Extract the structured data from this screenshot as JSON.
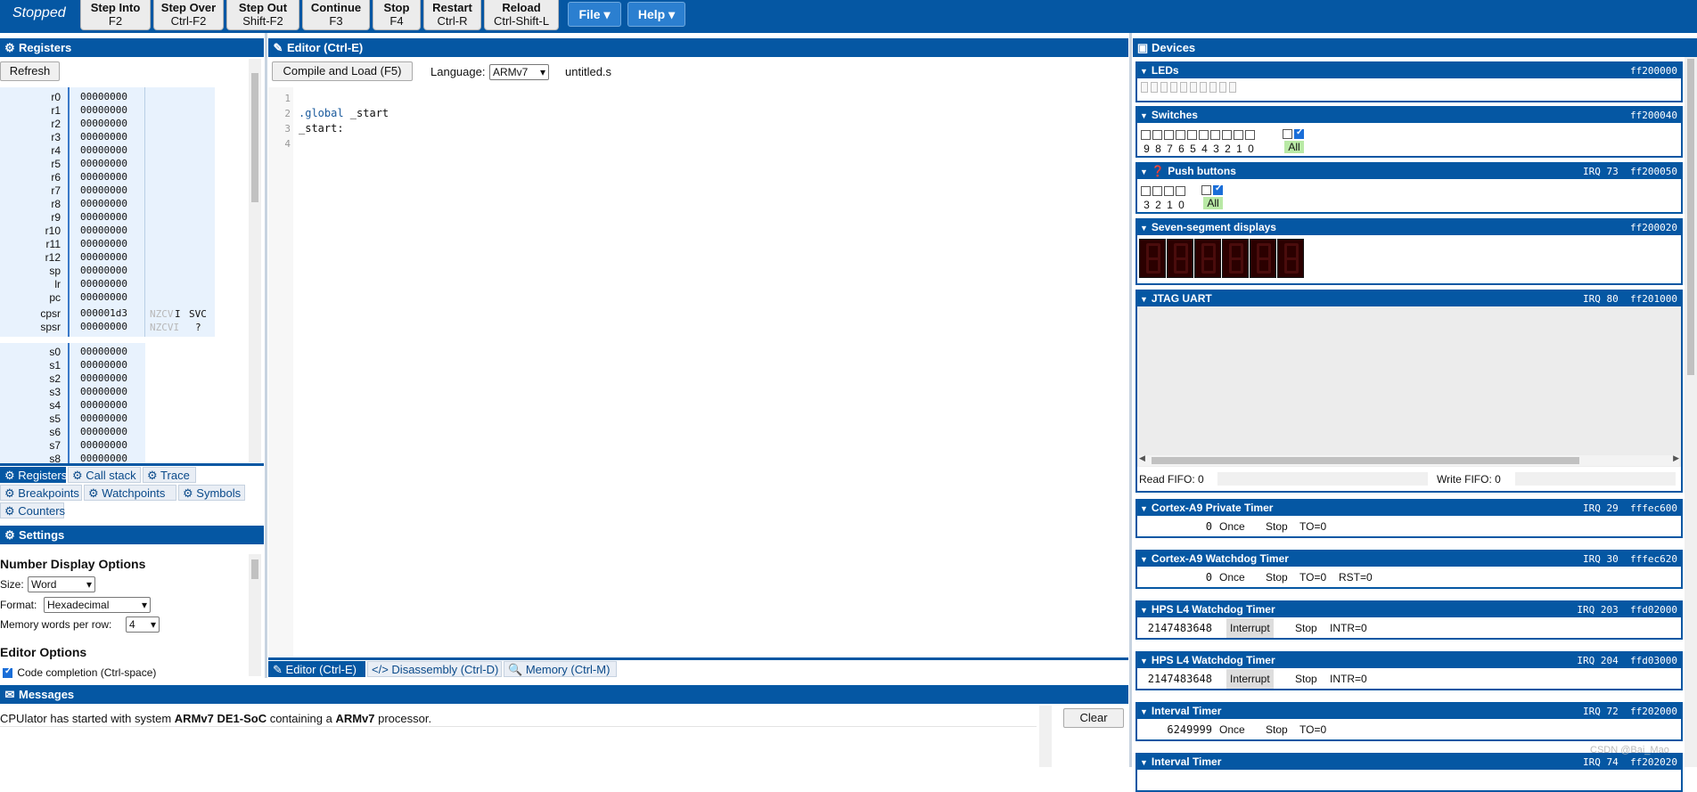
{
  "toolbar": {
    "status": "Stopped",
    "buttons": [
      {
        "label": "Step Into",
        "key": "F2"
      },
      {
        "label": "Step Over",
        "key": "Ctrl-F2"
      },
      {
        "label": "Step Out",
        "key": "Shift-F2"
      },
      {
        "label": "Continue",
        "key": "F3"
      },
      {
        "label": "Stop",
        "key": "F4"
      },
      {
        "label": "Restart",
        "key": "Ctrl-R"
      },
      {
        "label": "Reload",
        "key": "Ctrl-Shift-L"
      }
    ],
    "menus": [
      "File",
      "Help"
    ]
  },
  "registers": {
    "title": "Registers",
    "refresh": "Refresh",
    "core": [
      {
        "name": "r0",
        "value": "00000000"
      },
      {
        "name": "r1",
        "value": "00000000"
      },
      {
        "name": "r2",
        "value": "00000000"
      },
      {
        "name": "r3",
        "value": "00000000"
      },
      {
        "name": "r4",
        "value": "00000000"
      },
      {
        "name": "r5",
        "value": "00000000"
      },
      {
        "name": "r6",
        "value": "00000000"
      },
      {
        "name": "r7",
        "value": "00000000"
      },
      {
        "name": "r8",
        "value": "00000000"
      },
      {
        "name": "r9",
        "value": "00000000"
      },
      {
        "name": "r10",
        "value": "00000000"
      },
      {
        "name": "r11",
        "value": "00000000"
      },
      {
        "name": "r12",
        "value": "00000000"
      },
      {
        "name": "sp",
        "value": "00000000"
      },
      {
        "name": "lr",
        "value": "00000000"
      },
      {
        "name": "pc",
        "value": "00000000"
      }
    ],
    "cpsr": {
      "name": "cpsr",
      "value": "000001d3",
      "flags": "NZCV",
      "flag_i": "I",
      "mode": "SVC"
    },
    "spsr": {
      "name": "spsr",
      "value": "00000000",
      "flags": "NZCVI",
      "mode": "?"
    },
    "fp": [
      {
        "name": "s0",
        "value": "00000000"
      },
      {
        "name": "s1",
        "value": "00000000"
      },
      {
        "name": "s2",
        "value": "00000000"
      },
      {
        "name": "s3",
        "value": "00000000"
      },
      {
        "name": "s4",
        "value": "00000000"
      },
      {
        "name": "s5",
        "value": "00000000"
      },
      {
        "name": "s6",
        "value": "00000000"
      },
      {
        "name": "s7",
        "value": "00000000"
      },
      {
        "name": "s8",
        "value": "00000000"
      }
    ],
    "tabs": [
      "Registers",
      "Call stack",
      "Trace",
      "Breakpoints",
      "Watchpoints",
      "Symbols",
      "Counters"
    ]
  },
  "settings": {
    "title": "Settings",
    "number_display": "Number Display Options",
    "size_label": "Size:",
    "size_value": "Word",
    "format_label": "Format:",
    "format_value": "Hexadecimal",
    "memwords_label": "Memory words per row:",
    "memwords_value": "4",
    "editor_options": "Editor Options",
    "code_completion": "Code completion (Ctrl-space)"
  },
  "editor": {
    "title": "Editor (Ctrl-E)",
    "compile": "Compile and Load (F5)",
    "language_label": "Language:",
    "language_value": "ARMv7",
    "filename": "untitled.s",
    "line_numbers": [
      "1",
      "2",
      "3",
      "4"
    ],
    "code_line1_directive": ".global",
    "code_line1_symbol": " _start",
    "code_line2": "_start:",
    "tabs": [
      "Editor (Ctrl-E)",
      "Disassembly (Ctrl-D)",
      "Memory (Ctrl-M)"
    ]
  },
  "messages": {
    "title": "Messages",
    "clear": "Clear",
    "text_1": "CPUlator has started with system ",
    "system": "ARMv7 DE1-SoC",
    "text_2": " containing a ",
    "processor": "ARMv7",
    "text_3": " processor."
  },
  "devices": {
    "title": "Devices",
    "leds": {
      "title": "LEDs",
      "addr": "ff200000"
    },
    "switches": {
      "title": "Switches",
      "addr": "ff200040",
      "labels": [
        "9",
        "8",
        "7",
        "6",
        "5",
        "4",
        "3",
        "2",
        "1",
        "0"
      ],
      "all": "All"
    },
    "push": {
      "title": "Push buttons",
      "irq": "IRQ 73",
      "addr": "ff200050",
      "labels": [
        "3",
        "2",
        "1",
        "0"
      ],
      "all": "All"
    },
    "seven_seg": {
      "title": "Seven-segment displays",
      "addr": "ff200020"
    },
    "jtag": {
      "title": "JTAG UART",
      "irq": "IRQ 80",
      "addr": "ff201000",
      "read_fifo": "Read FIFO: 0",
      "write_fifo": "Write FIFO: 0"
    },
    "timers": [
      {
        "title": "Cortex-A9 Private Timer",
        "irq": "IRQ 29",
        "addr": "fffec600",
        "count": "0",
        "mode": "Once",
        "action": "Stop",
        "status1": "TO=0",
        "status2": ""
      },
      {
        "title": "Cortex-A9 Watchdog Timer",
        "irq": "IRQ 30",
        "addr": "fffec620",
        "count": "0",
        "mode": "Once",
        "action": "Stop",
        "status1": "TO=0",
        "status2": "RST=0"
      },
      {
        "title": "HPS L4 Watchdog Timer",
        "irq": "IRQ 203",
        "addr": "ffd02000",
        "count": "2147483648",
        "mode": "Interrupt",
        "action": "Stop",
        "status1": "INTR=0",
        "status2": ""
      },
      {
        "title": "HPS L4 Watchdog Timer",
        "irq": "IRQ 204",
        "addr": "ffd03000",
        "count": "2147483648",
        "mode": "Interrupt",
        "action": "Stop",
        "status1": "INTR=0",
        "status2": ""
      },
      {
        "title": "Interval Timer",
        "irq": "IRQ 72",
        "addr": "ff202000",
        "count": "6249999",
        "mode": "Once",
        "action": "Stop",
        "status1": "TO=0",
        "status2": ""
      },
      {
        "title": "Interval Timer",
        "irq": "IRQ 74",
        "addr": "ff202020",
        "count": "",
        "mode": "",
        "action": "",
        "status1": "",
        "status2": ""
      }
    ]
  },
  "watermark": "CSDN @Bai_Mao",
  "colors": {
    "accent": "#0557a3",
    "register_bg": "#e8f2fd",
    "all_green": "#b9e9a6",
    "seg_bg": "#2b0000"
  }
}
